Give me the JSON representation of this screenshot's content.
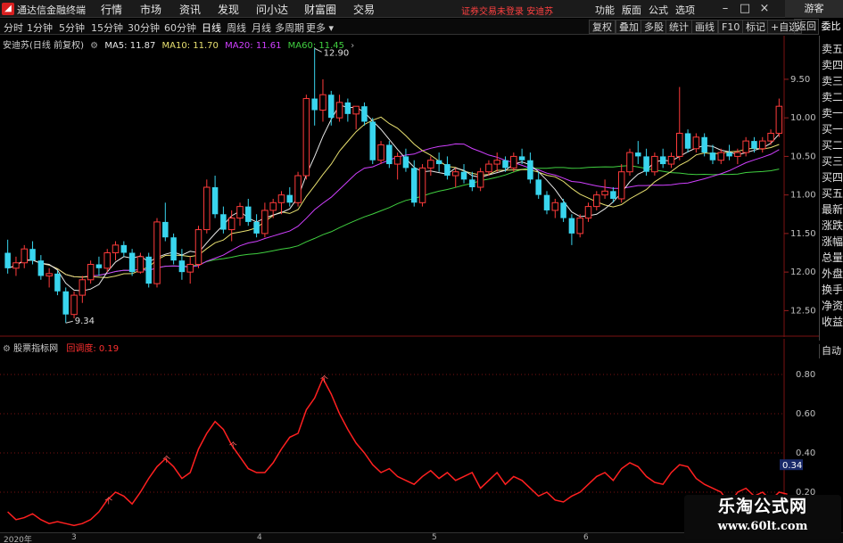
{
  "app": {
    "title": "通达信金融终端",
    "menus": [
      "行情",
      "市场",
      "资讯",
      "发现",
      "问小达",
      "财富圈",
      "交易"
    ],
    "login_status": "证券交易未登录",
    "stock_name_top": "安迪苏",
    "sys_menus": [
      "功能",
      "版面",
      "公式",
      "选项"
    ],
    "guest_label": "游客"
  },
  "periods": {
    "items": [
      "分时",
      "1分钟",
      "5分钟",
      "15分钟",
      "30分钟",
      "60分钟",
      "日线",
      "周线",
      "月线",
      "多周期",
      "更多"
    ],
    "active": "日线"
  },
  "toolbar": {
    "buttons": [
      "复权",
      "叠加",
      "多股",
      "统计",
      "画线",
      "F10",
      "标记",
      "+自选",
      "返回"
    ]
  },
  "side_panel": {
    "top_label": "委比",
    "items": [
      "卖五",
      "卖四",
      "卖三",
      "卖二",
      "卖一",
      "买一",
      "买二",
      "买三",
      "买四",
      "买五",
      "最新",
      "涨跌",
      "涨幅",
      "总量",
      "外盘",
      "换手",
      "净资",
      "收益"
    ],
    "auto_label": "自动"
  },
  "legend": {
    "title": "安迪苏(日线 前复权)",
    "ma5_label": "MA5: 11.87",
    "ma10_label": "MA10: 11.70",
    "ma20_label": "MA20: 11.61",
    "ma60_label": "MA60: 11.45"
  },
  "indicator": {
    "source_label": "股票指标网",
    "name_label": "回调度: 0.19",
    "current_value_label": "0.34"
  },
  "price_axis": {
    "ticks": [
      "12.50",
      "12.00",
      "11.50",
      "11.00",
      "10.50",
      "10.00",
      "9.50"
    ]
  },
  "indicator_axis": {
    "ticks": [
      "0.80",
      "0.60",
      "0.40",
      "0.20"
    ]
  },
  "annotations": {
    "high_label": "12.90",
    "low_label": "9.34"
  },
  "date_axis": {
    "labels": [
      "2020年",
      "3",
      "4",
      "5",
      "6"
    ]
  },
  "watermark": {
    "title": "乐淘公式网",
    "url": "www.60lt.com"
  },
  "colors": {
    "up": "#ff3b3b",
    "down": "#39d5ee",
    "ma5": "#e8e8e8",
    "ma10": "#e8e070",
    "ma20": "#d040ff",
    "ma60": "#40d040",
    "indicator": "#ff2020",
    "grid": "#7a1212"
  },
  "chart_data": [
    {
      "type": "candlestick",
      "title": "安迪苏(日线 前复权)",
      "series": [
        {
          "name": "MA5",
          "values": [
            11.87
          ]
        },
        {
          "name": "MA10",
          "values": [
            11.7
          ]
        },
        {
          "name": "MA20",
          "values": [
            11.61
          ]
        },
        {
          "name": "MA60",
          "values": [
            11.45
          ]
        }
      ],
      "ylim": [
        9.25,
        12.95
      ],
      "yticks": [
        9.5,
        10.0,
        10.5,
        11.0,
        11.5,
        12.0,
        12.5
      ],
      "candles": [
        [
          10.25,
          10.42,
          9.98,
          10.05
        ],
        [
          10.05,
          10.2,
          9.95,
          10.12
        ],
        [
          10.12,
          10.35,
          10.05,
          10.3
        ],
        [
          10.3,
          10.4,
          10.1,
          10.15
        ],
        [
          10.15,
          10.22,
          9.9,
          9.95
        ],
        [
          9.95,
          10.05,
          9.8,
          9.98
        ],
        [
          9.98,
          10.02,
          9.7,
          9.75
        ],
        [
          9.75,
          9.8,
          9.34,
          9.45
        ],
        [
          9.45,
          9.75,
          9.4,
          9.7
        ],
        [
          9.7,
          9.95,
          9.6,
          9.9
        ],
        [
          9.9,
          10.15,
          9.85,
          10.1
        ],
        [
          10.1,
          10.2,
          9.95,
          10.05
        ],
        [
          10.05,
          10.3,
          10.0,
          10.25
        ],
        [
          10.25,
          10.4,
          10.15,
          10.35
        ],
        [
          10.35,
          10.4,
          10.2,
          10.25
        ],
        [
          10.25,
          10.3,
          9.95,
          10.0
        ],
        [
          10.0,
          10.25,
          9.98,
          10.2
        ],
        [
          10.2,
          10.25,
          9.8,
          9.85
        ],
        [
          9.85,
          10.7,
          9.8,
          10.65
        ],
        [
          10.65,
          10.9,
          10.4,
          10.45
        ],
        [
          10.45,
          10.5,
          10.1,
          10.15
        ],
        [
          10.15,
          10.3,
          9.9,
          10.0
        ],
        [
          10.0,
          10.2,
          9.85,
          10.1
        ],
        [
          10.1,
          10.6,
          10.05,
          10.55
        ],
        [
          10.55,
          11.2,
          10.5,
          11.1
        ],
        [
          11.1,
          11.25,
          10.7,
          10.75
        ],
        [
          10.75,
          10.85,
          10.5,
          10.55
        ],
        [
          10.55,
          10.8,
          10.4,
          10.7
        ],
        [
          10.7,
          10.9,
          10.6,
          10.85
        ],
        [
          10.85,
          10.95,
          10.6,
          10.65
        ],
        [
          10.65,
          10.75,
          10.45,
          10.5
        ],
        [
          10.5,
          10.9,
          10.45,
          10.8
        ],
        [
          10.8,
          10.95,
          10.7,
          10.9
        ],
        [
          10.9,
          11.05,
          10.75,
          11.0
        ],
        [
          11.0,
          11.1,
          10.85,
          10.9
        ],
        [
          10.9,
          11.3,
          10.85,
          11.25
        ],
        [
          11.25,
          12.3,
          11.2,
          12.25
        ],
        [
          12.25,
          12.9,
          11.9,
          12.1
        ],
        [
          12.1,
          12.5,
          11.95,
          12.3
        ],
        [
          12.3,
          12.35,
          11.9,
          12.0
        ],
        [
          12.0,
          12.3,
          11.95,
          12.2
        ],
        [
          12.2,
          12.25,
          11.95,
          12.05
        ],
        [
          12.05,
          12.15,
          11.85,
          12.15
        ],
        [
          12.15,
          12.2,
          11.9,
          11.95
        ],
        [
          11.95,
          12.0,
          11.4,
          11.45
        ],
        [
          11.45,
          11.7,
          11.4,
          11.65
        ],
        [
          11.65,
          11.7,
          11.35,
          11.4
        ],
        [
          11.4,
          11.55,
          11.2,
          11.5
        ],
        [
          11.5,
          11.6,
          11.3,
          11.35
        ],
        [
          11.35,
          11.45,
          10.85,
          10.9
        ],
        [
          10.9,
          11.4,
          10.85,
          11.35
        ],
        [
          11.35,
          11.5,
          11.25,
          11.45
        ],
        [
          11.45,
          11.55,
          11.3,
          11.4
        ],
        [
          11.4,
          11.5,
          11.2,
          11.25
        ],
        [
          11.25,
          11.35,
          11.1,
          11.3
        ],
        [
          11.3,
          11.4,
          11.15,
          11.2
        ],
        [
          11.2,
          11.3,
          11.05,
          11.1
        ],
        [
          11.1,
          11.35,
          11.05,
          11.3
        ],
        [
          11.3,
          11.45,
          11.25,
          11.4
        ],
        [
          11.4,
          11.55,
          11.3,
          11.45
        ],
        [
          11.45,
          11.5,
          11.3,
          11.35
        ],
        [
          11.35,
          11.55,
          11.3,
          11.5
        ],
        [
          11.5,
          11.6,
          11.4,
          11.45
        ],
        [
          11.45,
          11.55,
          11.15,
          11.2
        ],
        [
          11.2,
          11.3,
          10.95,
          11.0
        ],
        [
          11.0,
          11.05,
          10.75,
          10.8
        ],
        [
          10.8,
          10.95,
          10.7,
          10.9
        ],
        [
          10.9,
          10.95,
          10.65,
          10.7
        ],
        [
          10.7,
          10.75,
          10.35,
          10.5
        ],
        [
          10.5,
          10.75,
          10.45,
          10.7
        ],
        [
          10.7,
          10.9,
          10.65,
          10.85
        ],
        [
          10.85,
          11.05,
          10.8,
          11.0
        ],
        [
          11.0,
          11.2,
          10.95,
          11.05
        ],
        [
          11.05,
          11.1,
          10.9,
          10.95
        ],
        [
          10.95,
          11.4,
          10.9,
          11.3
        ],
        [
          11.3,
          11.6,
          11.25,
          11.55
        ],
        [
          11.55,
          11.7,
          11.4,
          11.5
        ],
        [
          11.5,
          11.6,
          11.25,
          11.3
        ],
        [
          11.3,
          11.55,
          11.25,
          11.5
        ],
        [
          11.5,
          11.6,
          11.35,
          11.4
        ],
        [
          11.4,
          11.55,
          11.35,
          11.5
        ],
        [
          11.5,
          12.4,
          11.45,
          11.8
        ],
        [
          11.8,
          11.85,
          11.55,
          11.6
        ],
        [
          11.6,
          11.8,
          11.55,
          11.75
        ],
        [
          11.75,
          11.8,
          11.5,
          11.55
        ],
        [
          11.55,
          11.65,
          11.4,
          11.45
        ],
        [
          11.45,
          11.6,
          11.4,
          11.55
        ],
        [
          11.55,
          11.65,
          11.45,
          11.5
        ],
        [
          11.5,
          11.6,
          11.4,
          11.55
        ],
        [
          11.55,
          11.75,
          11.5,
          11.7
        ],
        [
          11.7,
          11.75,
          11.55,
          11.6
        ],
        [
          11.6,
          11.75,
          11.55,
          11.7
        ],
        [
          11.7,
          11.85,
          11.65,
          11.8
        ],
        [
          11.8,
          12.25,
          11.75,
          12.15
        ]
      ]
    },
    {
      "type": "line",
      "title": "回调度",
      "series": [
        {
          "name": "回调度",
          "values": [
            0.1,
            0.06,
            0.07,
            0.09,
            0.06,
            0.04,
            0.05,
            0.04,
            0.03,
            0.04,
            0.06,
            0.1,
            0.16,
            0.2,
            0.18,
            0.14,
            0.2,
            0.27,
            0.33,
            0.37,
            0.33,
            0.27,
            0.3,
            0.42,
            0.5,
            0.56,
            0.52,
            0.44,
            0.38,
            0.32,
            0.3,
            0.3,
            0.35,
            0.42,
            0.48,
            0.5,
            0.62,
            0.68,
            0.78,
            0.7,
            0.6,
            0.52,
            0.45,
            0.4,
            0.34,
            0.3,
            0.32,
            0.28,
            0.26,
            0.24,
            0.28,
            0.31,
            0.27,
            0.3,
            0.26,
            0.28,
            0.3,
            0.22,
            0.26,
            0.3,
            0.24,
            0.28,
            0.26,
            0.22,
            0.18,
            0.2,
            0.16,
            0.15,
            0.18,
            0.2,
            0.24,
            0.28,
            0.3,
            0.26,
            0.32,
            0.35,
            0.33,
            0.28,
            0.25,
            0.24,
            0.3,
            0.34,
            0.33,
            0.27,
            0.24,
            0.22,
            0.2,
            0.14,
            0.2,
            0.22,
            0.18,
            0.2,
            0.16,
            0.2,
            0.19
          ]
        }
      ],
      "ylim": [
        0.0,
        0.9
      ],
      "yticks": [
        0.2,
        0.4,
        0.6,
        0.8
      ]
    }
  ]
}
